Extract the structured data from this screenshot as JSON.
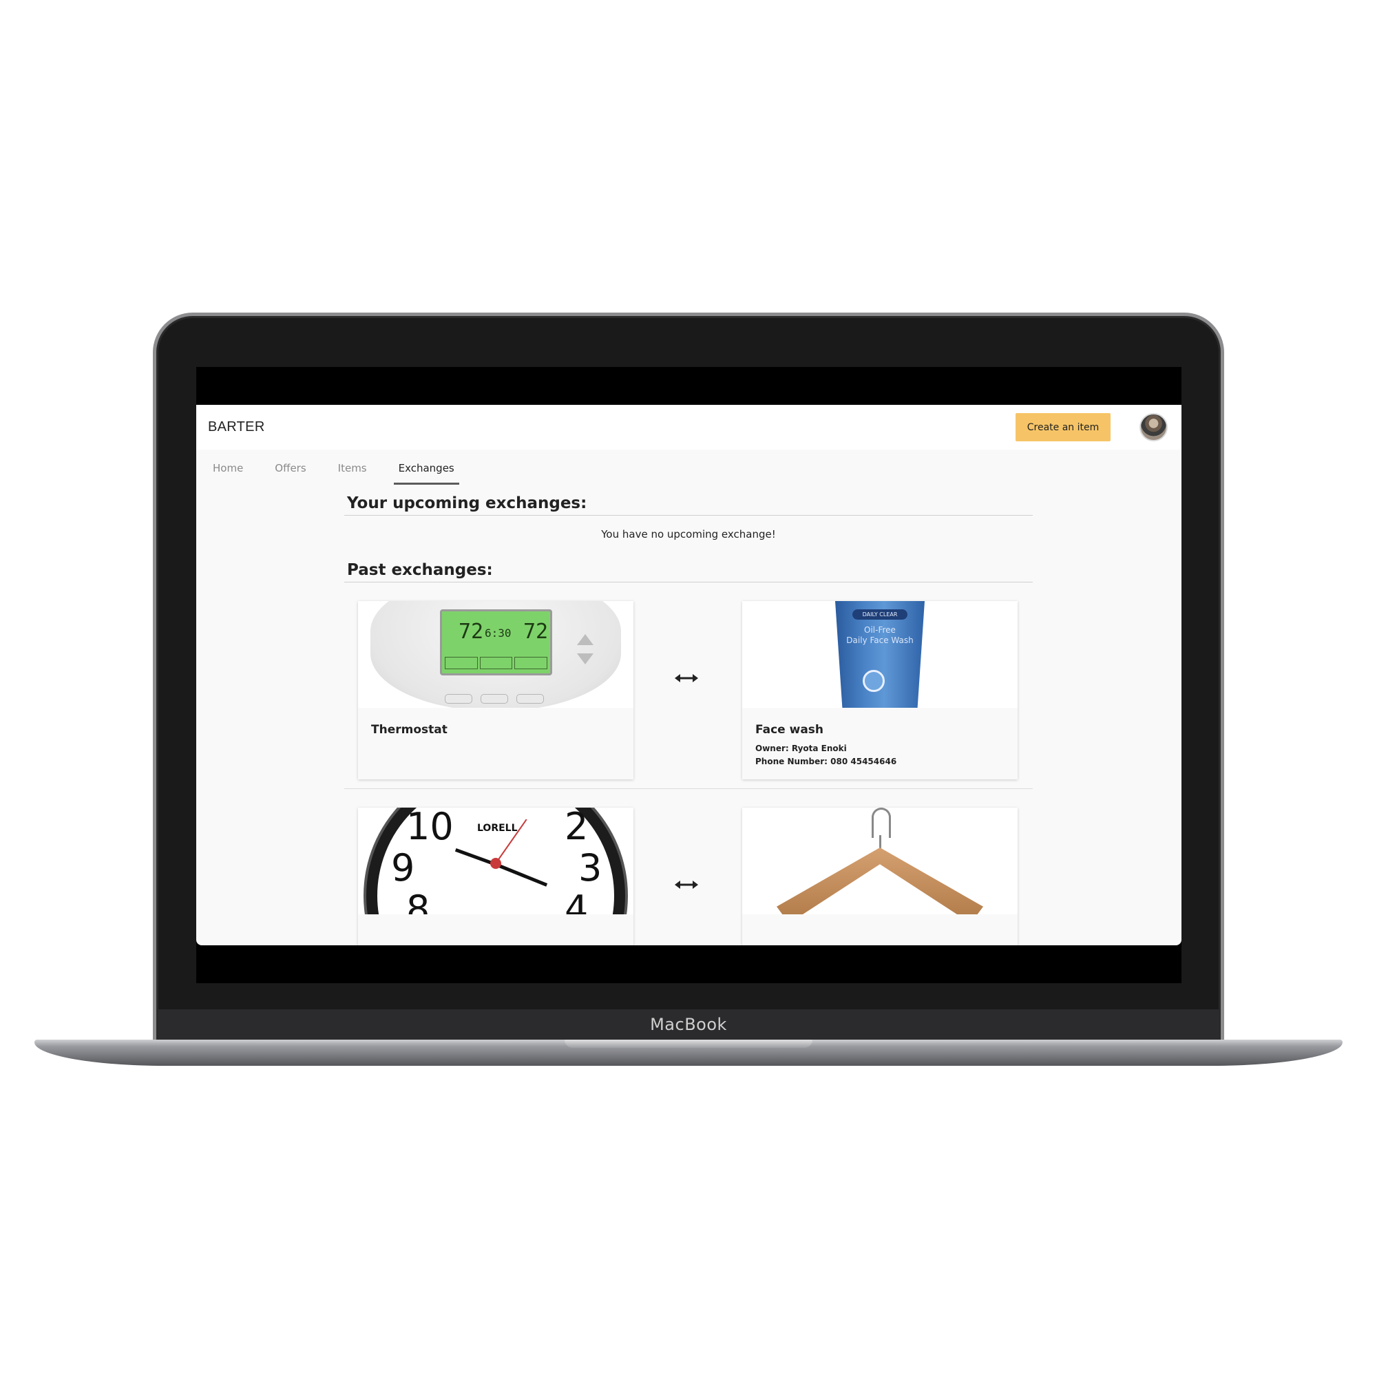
{
  "app": {
    "logo": "BARTER",
    "create_button": "Create an item",
    "avatar_alt": "User avatar"
  },
  "tabs": [
    {
      "label": "Home"
    },
    {
      "label": "Offers"
    },
    {
      "label": "Items"
    },
    {
      "label": "Exchanges",
      "active": true
    }
  ],
  "upcoming": {
    "title": "Your upcoming exchanges:",
    "empty_message": "You have no upcoming exchange!"
  },
  "past": {
    "title": "Past exchanges:",
    "exchanges": [
      {
        "mine": {
          "title": "Thermostat"
        },
        "theirs": {
          "title": "Face wash",
          "owner": "Owner: Ryota Enoki",
          "phone": "Phone Number: 080 45454646"
        }
      },
      {
        "mine": {
          "title": ""
        },
        "theirs": {
          "title": ""
        }
      }
    ]
  },
  "device": {
    "brand": "MacBook"
  },
  "art": {
    "thermostat": {
      "temp_left": "72",
      "time": "6:30",
      "temp_right": "72"
    },
    "facewash": {
      "tag": "DAILY CLEAR",
      "line1": "Oil-Free",
      "line2": "Daily Face Wash"
    },
    "clock": {
      "brand": "LORELL",
      "n10": "10",
      "n9": "9",
      "n8": "8",
      "n3": "3",
      "n4": "4",
      "n2": "2"
    }
  },
  "colors": {
    "accent": "#f6c466",
    "background": "#f9f9f9",
    "lcd": "#7ed26a"
  },
  "icons": {
    "swap": "swap-arrow-icon"
  }
}
